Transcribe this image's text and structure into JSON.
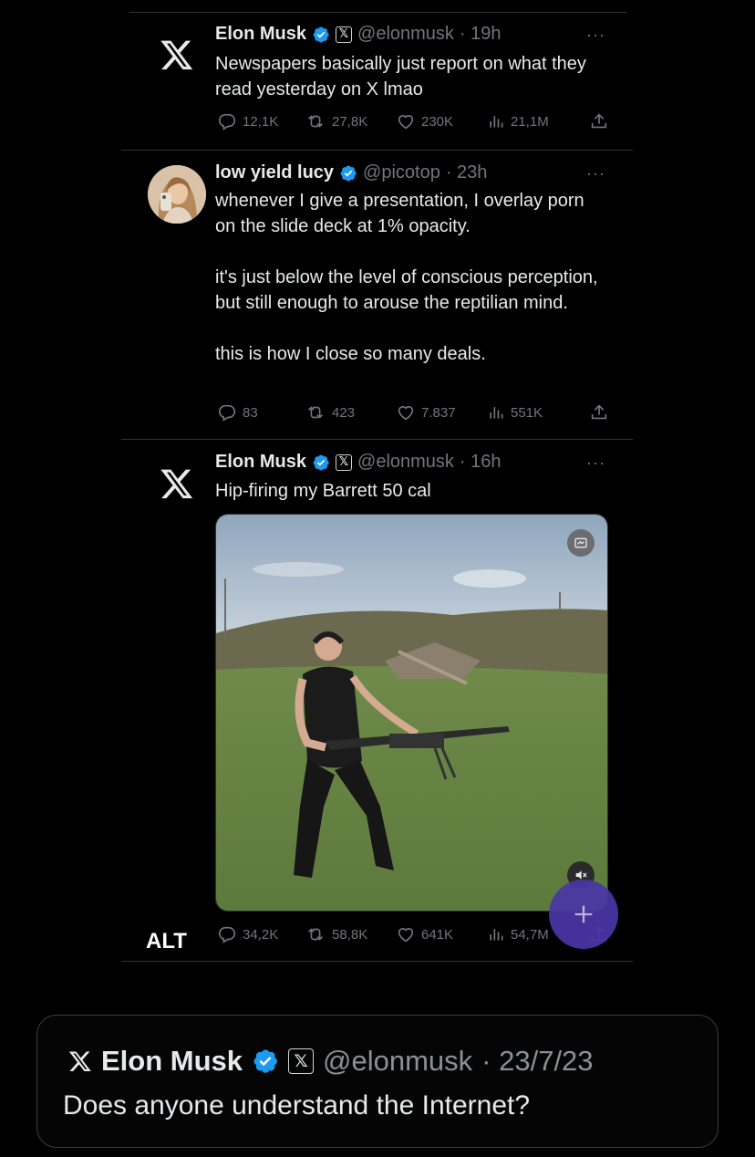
{
  "tweets": [
    {
      "name": "Elon Musk",
      "handle": "@elonmusk",
      "time": "· 19h",
      "text": "Newspapers basically just report on what they read yesterday on X lmao",
      "replies": "12,1K",
      "reposts": "27,8K",
      "likes": "230K",
      "views": "21,1M",
      "avatar_icon": "x-logo-icon"
    },
    {
      "name": "low yield lucy",
      "handle": "@picotop",
      "time": "· 23h",
      "text": "whenever I give a presentation, I overlay porn on the slide deck at 1% opacity.\n\nit's just below the level of conscious perception, but still enough to arouse the reptilian mind.\n\nthis is how I close so many deals.",
      "replies": "83",
      "reposts": "423",
      "likes": "7.837",
      "views": "551K",
      "avatar_icon": "profile-photo"
    },
    {
      "name": "Elon Musk",
      "handle": "@elonmusk",
      "time": "· 16h",
      "text": "Hip-firing my Barrett 50 cal",
      "replies": "34,2K",
      "reposts": "58,8K",
      "likes": "641K",
      "views": "54,7M",
      "avatar_icon": "x-logo-icon"
    }
  ],
  "more_label": "···",
  "x_badge": "𝕏",
  "alt_label": "ALT",
  "quote": {
    "name": "Elon Musk",
    "handle": "@elonmusk",
    "date": "· 23/7/23",
    "text": "Does anyone understand the Internet?"
  },
  "colors": {
    "background": "#000000",
    "text": "#e7e9ea",
    "muted": "#71767b",
    "verified": "#1d9bf0",
    "fab": "#4a36a8"
  },
  "icons": [
    "x-logo-icon",
    "verified-badge-icon",
    "reply-icon",
    "repost-icon",
    "like-icon",
    "views-icon",
    "share-icon",
    "gif-icon",
    "mute-icon",
    "plus-icon"
  ]
}
